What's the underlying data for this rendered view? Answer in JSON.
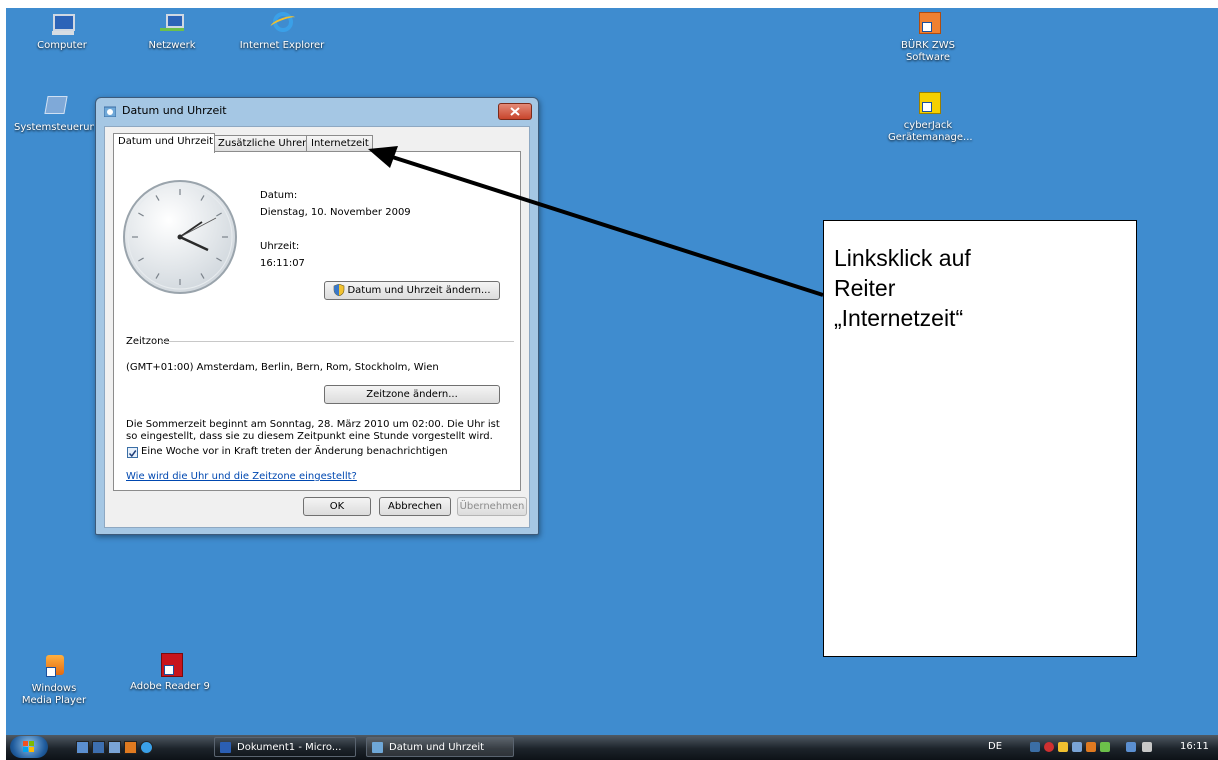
{
  "desktop": {
    "icons": [
      {
        "label": "Computer",
        "icon": "computer-icon"
      },
      {
        "label": "Netzwerk",
        "icon": "network-icon"
      },
      {
        "label": "Internet Explorer",
        "icon": "ie-icon"
      },
      {
        "label": "Systemsteuerung",
        "icon": "control-panel-icon"
      },
      {
        "label": "BÜRK ZWS Software",
        "icon": "buerk-icon"
      },
      {
        "label": "cyberJack Gerätemanage...",
        "icon": "cyberjack-icon"
      },
      {
        "label": "Windows Media Player",
        "icon": "wmp-icon"
      },
      {
        "label": "Adobe Reader 9",
        "icon": "adobe-reader-icon"
      }
    ]
  },
  "dialog": {
    "title": "Datum und Uhrzeit",
    "tabs": [
      {
        "label": "Datum und Uhrzeit",
        "active": true
      },
      {
        "label": "Zusätzliche Uhren",
        "active": false
      },
      {
        "label": "Internetzeit",
        "active": false
      }
    ],
    "date_label": "Datum:",
    "date_value": "Dienstag, 10. November 2009",
    "time_label": "Uhrzeit:",
    "time_value": "16:11:07",
    "change_datetime_button": "Datum und Uhrzeit ändern...",
    "timezone_heading": "Zeitzone",
    "timezone_value": "(GMT+01:00) Amsterdam, Berlin, Bern, Rom, Stockholm, Wien",
    "change_timezone_button": "Zeitzone ändern...",
    "dst_line1": "Die Sommerzeit beginnt am Sonntag, 28. März 2010 um 02:00. Die Uhr ist",
    "dst_line2": "so eingestellt, dass sie zu diesem Zeitpunkt eine Stunde vorgestellt wird.",
    "notify_checkbox_label": "Eine Woche vor in Kraft treten der Änderung benachrichtigen",
    "notify_checked": true,
    "help_link": "Wie wird die Uhr und die Zeitzone eingestellt?",
    "ok_button": "OK",
    "cancel_button": "Abbrechen",
    "apply_button": "Übernehmen"
  },
  "annotation": {
    "text": "Linksklick auf\nReiter\n„Internetzeit“"
  },
  "taskbar": {
    "tasks": [
      {
        "label": "Dokument1 - Micro...",
        "icon": "word-icon"
      },
      {
        "label": "Datum und Uhrzeit",
        "icon": "datetime-icon"
      }
    ],
    "language": "DE",
    "clock": "16:11"
  },
  "colors": {
    "desktop": "#3f8ccf",
    "arrow": "#000000"
  }
}
